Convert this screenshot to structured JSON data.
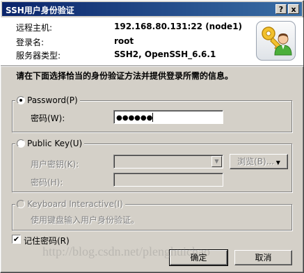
{
  "window": {
    "title": "SSH用户身份验证",
    "help_label": "?",
    "close_label": "x"
  },
  "info": {
    "remote_host_label": "远程主机:",
    "remote_host_value": "192.168.80.131:22 (node1)",
    "login_name_label": "登录名:",
    "login_name_value": "root",
    "server_type_label": "服务器类型:",
    "server_type_value": "SSH2, OpenSSH_6.6.1"
  },
  "instruction": "请在下面选择恰当的身份验证方法并提供登录所需的信息。",
  "password_group": {
    "radio_label": "Password(P)",
    "selected": true,
    "password_label": "密码(W):",
    "password_value": "●●●●●●"
  },
  "publickey_group": {
    "radio_label": "Public Key(U)",
    "selected": false,
    "user_key_label": "用户密钥(K):",
    "user_key_value": "",
    "browse_label": "浏览(B)...",
    "passphrase_label": "密码(H):",
    "passphrase_value": ""
  },
  "keyboard_group": {
    "radio_label": "Keyboard Interactive(I)",
    "selected": false,
    "description": "使用键盘输入用户身份验证。"
  },
  "remember_password": {
    "label": "记住密码(R)",
    "checked": true
  },
  "buttons": {
    "ok_label": "确定",
    "cancel_label": "取消"
  },
  "watermark": "http://blog.csdn.net/plenghuichao",
  "icon": "key-user-icon",
  "colors": {
    "titlebar_start": "#0a246a",
    "titlebar_end": "#3a6ea5",
    "dialog_bg": "#d4d0c8",
    "info_bg": "#ffffff"
  }
}
